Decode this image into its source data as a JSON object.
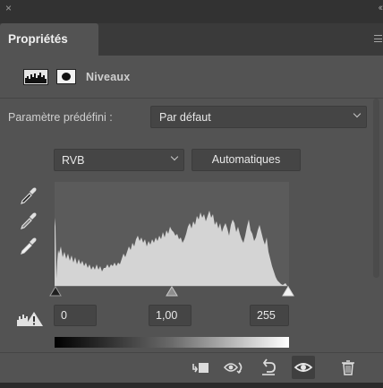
{
  "window": {
    "close_glyph": "×",
    "collapse_glyph": "‹‹"
  },
  "panel": {
    "tab_label": "Propriétés",
    "menu_icon": "panel-menu-icon"
  },
  "layer": {
    "title": "Niveaux",
    "icons": [
      "levels-adjustment-icon",
      "layer-mask-icon"
    ]
  },
  "preset": {
    "label": "Paramètre prédéfini :",
    "value": "Par défaut"
  },
  "channel": {
    "value": "RVB"
  },
  "auto_button": {
    "label": "Automatiques"
  },
  "eyedroppers": [
    "black-point-eyedropper-icon",
    "gray-point-eyedropper-icon",
    "white-point-eyedropper-icon"
  ],
  "inputs": {
    "shadows": "0",
    "midtones": "1,00",
    "highlights": "255"
  },
  "colors": {
    "panel_bg": "#535353",
    "field_bg": "#454545",
    "histogram_bg": "#5b5b5b",
    "histogram_fill": "#d4d4d4"
  },
  "toolbar": {
    "icons": [
      "clip-to-layer-icon",
      "view-previous-state-icon",
      "reset-icon",
      "visibility-eye-icon",
      "trash-icon"
    ]
  }
}
